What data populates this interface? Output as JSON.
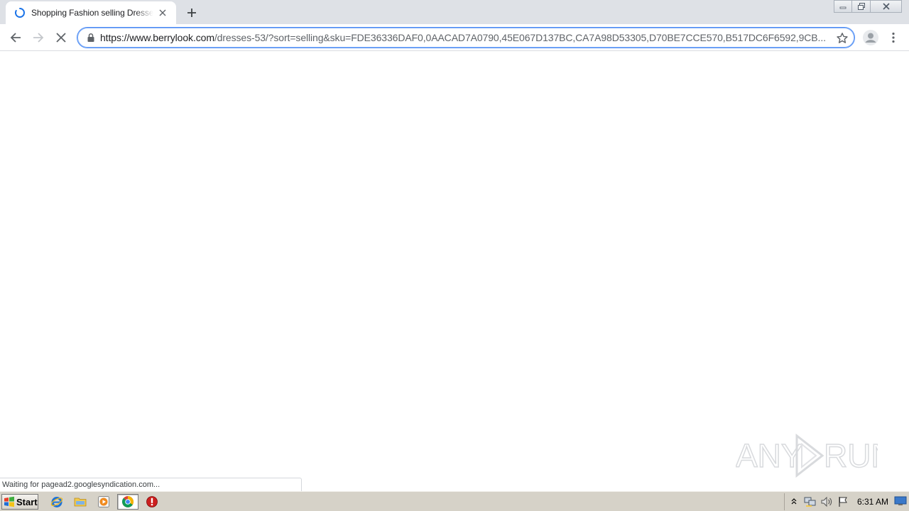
{
  "browser": {
    "tab": {
      "title": "Shopping Fashion selling Dresses on",
      "loading": true
    },
    "new_tab_icon": "plus-icon",
    "window_controls": [
      "minimize-icon",
      "restore-icon",
      "close-icon"
    ],
    "address_bar": {
      "host": "https://www.berrylook.com",
      "path": "/dresses-53/?sort=selling&sku=FDE36336DAF0,0AACAD7A0790,45E067D137BC,CA7A98D53305,D70BE7CCE570,B517DC6F6592,9CB..."
    }
  },
  "page": {
    "status_text": "Waiting for pagead2.googlesyndication.com...",
    "watermark": "ANY RUN"
  },
  "taskbar": {
    "start_label": "Start",
    "apps": [
      "internet-explorer-icon",
      "file-explorer-icon",
      "media-player-icon",
      "chrome-icon",
      "stop-sign-icon"
    ],
    "tray_icons": [
      "show-hidden-icons-arrow",
      "network-icon",
      "volume-icon",
      "action-center-flag-icon"
    ],
    "clock": "6:31 AM"
  },
  "colors": {
    "tabstrip_bg": "#dee1e6",
    "omnibox_focus": "#4a8af4",
    "taskbar_bg": "#d6d2c8"
  }
}
